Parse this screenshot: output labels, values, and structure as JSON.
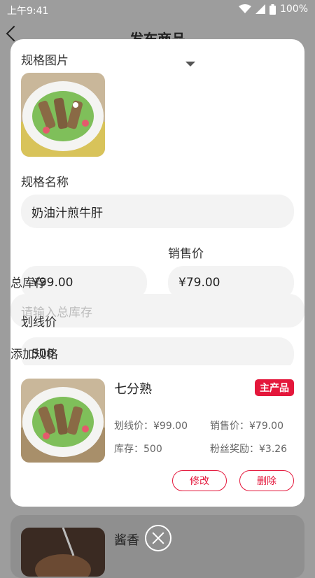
{
  "status": {
    "time": "上午9:41",
    "battery": "100%"
  },
  "navbar": {
    "title": "发布商品"
  },
  "spec": {
    "image_label": "规格图片",
    "name_label": "规格名称",
    "name_value": "奶油汁煎牛肝",
    "sale_price_label": "销售价",
    "strike_price_value": "¥99.00",
    "sale_price_value": "¥79.00",
    "stock_label": "总库存",
    "stock_placeholder": "请输入总库存",
    "strike_label": "划线价",
    "stock_value": "500",
    "add_spec_label": "添加规格"
  },
  "card": {
    "name": "七分熟",
    "badge": "主产品",
    "strike_price": "划线价：¥99.00",
    "sale_price": "销售价：¥79.00",
    "stock": "库存：500",
    "fan_reward": "粉丝奖励：¥3.26",
    "edit_label": "修改",
    "delete_label": "删除"
  },
  "background": {
    "item_name": "酱香"
  },
  "colors": {
    "accent": "#e4173b"
  }
}
